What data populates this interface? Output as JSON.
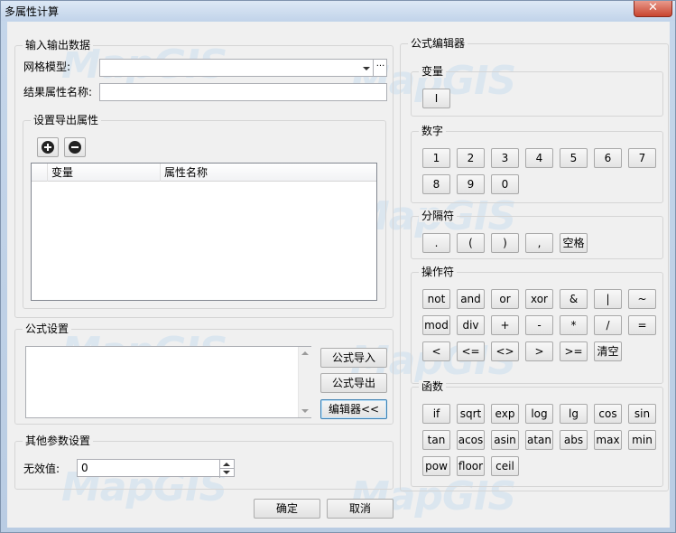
{
  "window": {
    "title": "多属性计算",
    "close_glyph": "✕"
  },
  "watermark": "MapGIS",
  "io_group": {
    "label": "输入输出数据",
    "grid_model_label": "网格模型:",
    "grid_model_value": "",
    "browse_label": "···",
    "result_attr_label": "结果属性名称:",
    "result_attr_value": ""
  },
  "export_group": {
    "label": "设置导出属性",
    "add_icon": "plus-circle-icon",
    "remove_icon": "minus-circle-icon",
    "columns": [
      "",
      "变量",
      "属性名称"
    ],
    "rows": []
  },
  "formula_group": {
    "label": "公式设置",
    "text": "",
    "import_label": "公式导入",
    "export_label": "公式导出",
    "editor_label": "编辑器<<"
  },
  "other_group": {
    "label": "其他参数设置",
    "invalid_label": "无效值:",
    "invalid_value": "0"
  },
  "editor": {
    "label": "公式编辑器",
    "variables": {
      "label": "变量",
      "items": [
        "I"
      ]
    },
    "digits": {
      "label": "数字",
      "items": [
        "1",
        "2",
        "3",
        "4",
        "5",
        "6",
        "7",
        "8",
        "9",
        "0"
      ]
    },
    "separators": {
      "label": "分隔符",
      "items": [
        ".",
        "(",
        ")",
        ",",
        "空格"
      ]
    },
    "operators": {
      "label": "操作符",
      "items": [
        "not",
        "and",
        "or",
        "xor",
        "&",
        "|",
        "~",
        "mod",
        "div",
        "+",
        "-",
        "*",
        "/",
        "=",
        "<",
        "<=",
        "<>",
        ">",
        ">=",
        "清空"
      ]
    },
    "functions": {
      "label": "函数",
      "items": [
        "if",
        "sqrt",
        "exp",
        "log",
        "lg",
        "cos",
        "sin",
        "tan",
        "acos",
        "asin",
        "atan",
        "abs",
        "max",
        "min",
        "pow",
        "floor",
        "ceil"
      ]
    }
  },
  "footer": {
    "ok_label": "确定",
    "cancel_label": "取消"
  }
}
